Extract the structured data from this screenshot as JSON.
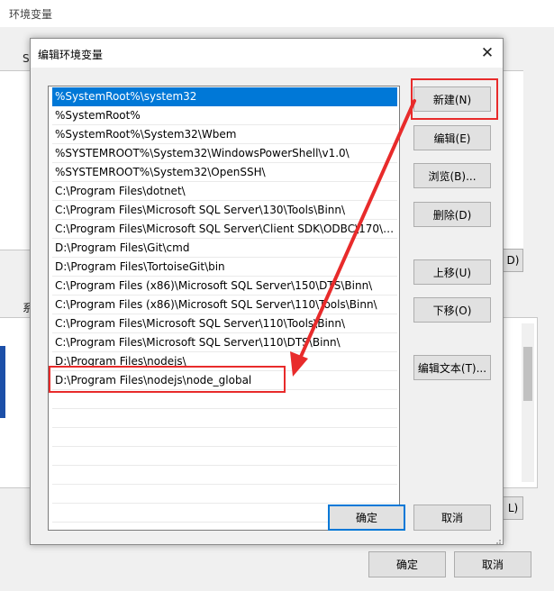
{
  "background_window": {
    "title": "环境变量",
    "fragments": {
      "left_s": "S",
      "left_sys": "系",
      "btn_d": "D)",
      "btn_l": "L)"
    },
    "ok_label": "确定",
    "cancel_label": "取消"
  },
  "dialog": {
    "title": "编辑环境变量",
    "close_glyph": "✕",
    "paths": [
      "%SystemRoot%\\system32",
      "%SystemRoot%",
      "%SystemRoot%\\System32\\Wbem",
      "%SYSTEMROOT%\\System32\\WindowsPowerShell\\v1.0\\",
      "%SYSTEMROOT%\\System32\\OpenSSH\\",
      "C:\\Program Files\\dotnet\\",
      "C:\\Program Files\\Microsoft SQL Server\\130\\Tools\\Binn\\",
      "C:\\Program Files\\Microsoft SQL Server\\Client SDK\\ODBC\\170\\T...",
      "D:\\Program Files\\Git\\cmd",
      "D:\\Program Files\\TortoiseGit\\bin",
      "C:\\Program Files (x86)\\Microsoft SQL Server\\150\\DTS\\Binn\\",
      "C:\\Program Files (x86)\\Microsoft SQL Server\\110\\Tools\\Binn\\",
      "C:\\Program Files\\Microsoft SQL Server\\110\\Tools\\Binn\\",
      "C:\\Program Files\\Microsoft SQL Server\\110\\DTS\\Binn\\",
      "D:\\Program Files\\nodejs\\",
      "D:\\Program Files\\nodejs\\node_global"
    ],
    "buttons": {
      "new": "新建(N)",
      "edit": "编辑(E)",
      "browse": "浏览(B)...",
      "delete": "删除(D)",
      "move_up": "上移(U)",
      "move_down": "下移(O)",
      "edit_text": "编辑文本(T)..."
    },
    "ok_label": "确定",
    "cancel_label": "取消"
  },
  "colors": {
    "selection": "#0078d7",
    "annotation": "#e82b2b"
  }
}
